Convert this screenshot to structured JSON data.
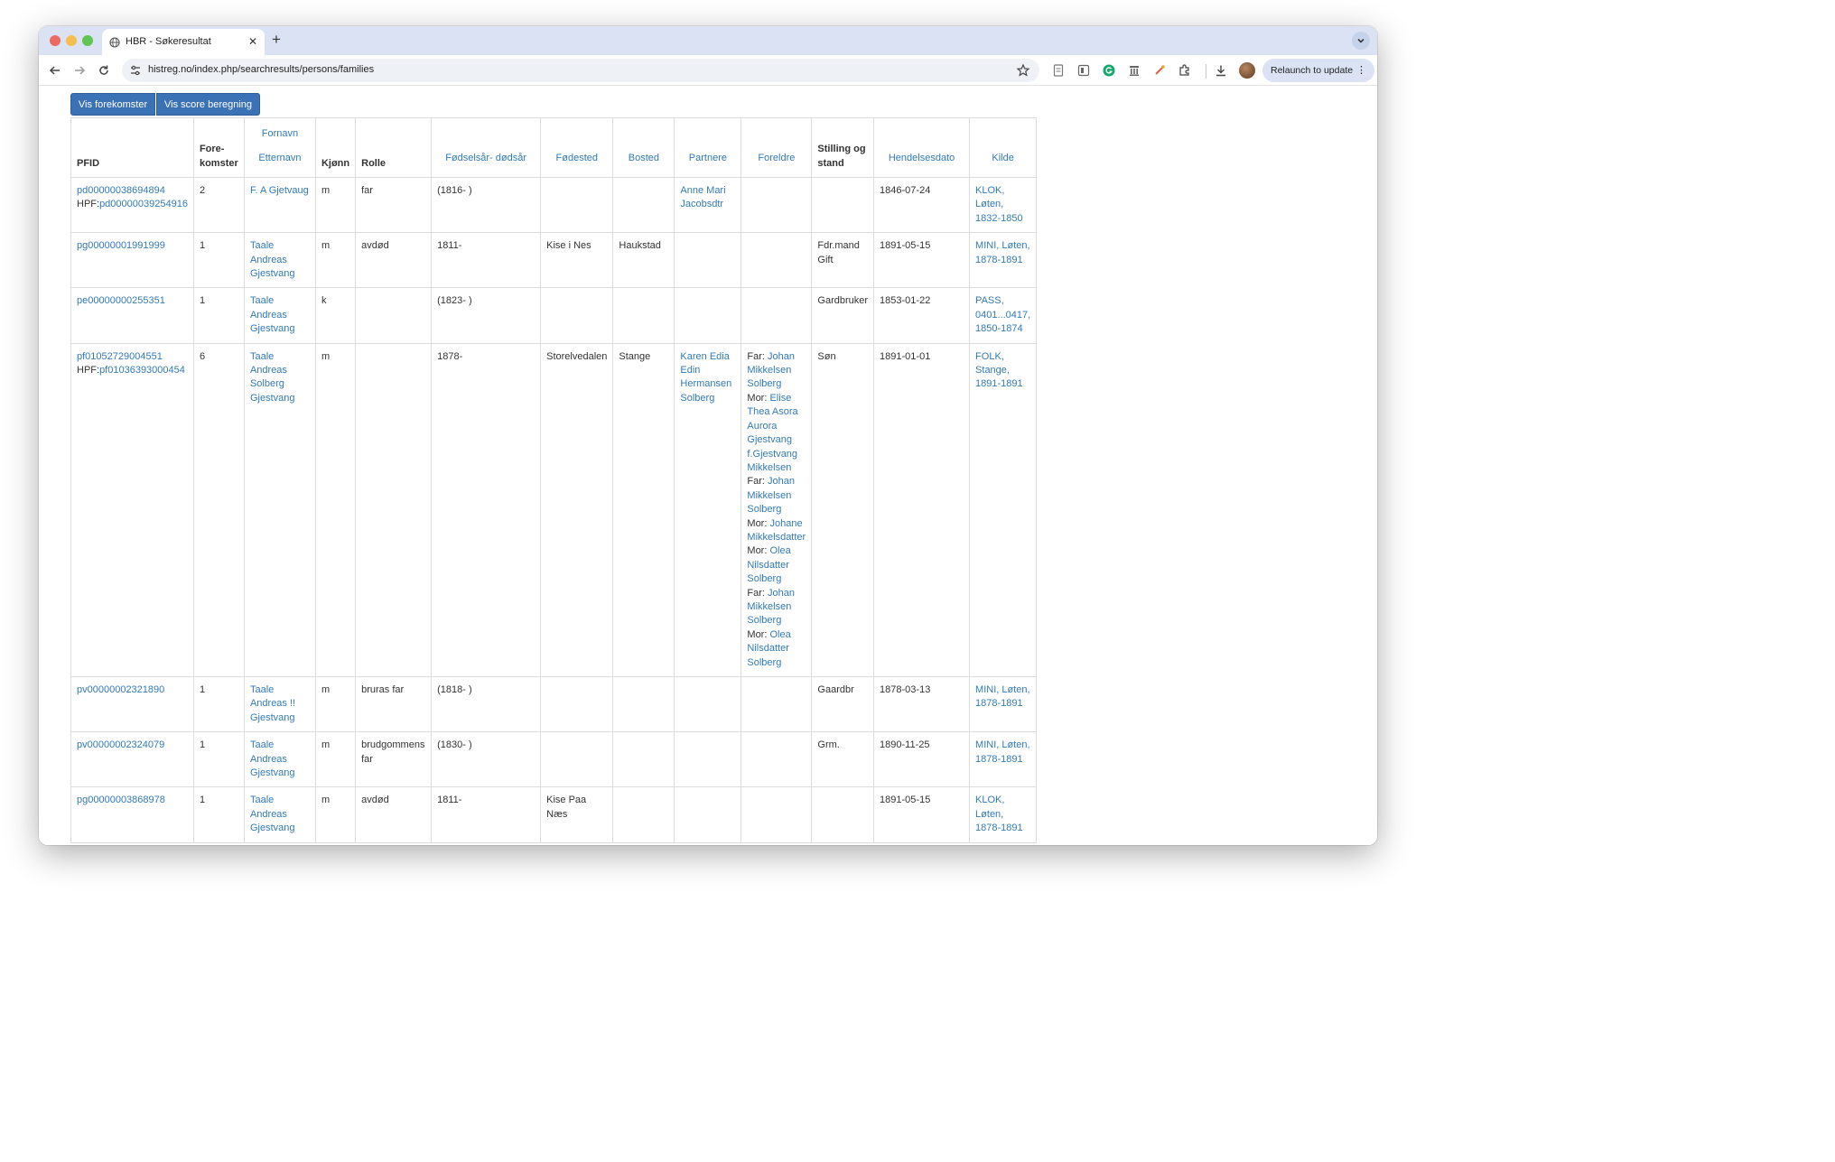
{
  "browser": {
    "tab_title": "HBR - Søkeresultat",
    "url": "histreg.no/index.php/searchresults/persons/families",
    "relaunch_label": "Relaunch to update",
    "new_tab_symbol": "+",
    "close_symbol": "✕"
  },
  "buttons": {
    "show_occurrences": "Vis forekomster",
    "show_score": "Vis score beregning"
  },
  "table": {
    "headers": {
      "pfid": "PFID",
      "occurrences": "Fore-\nkomster",
      "first_name": "Fornavn",
      "last_name": "Etternavn",
      "gender": "Kjønn",
      "role": "Rolle",
      "birth_death": "Fødselsår- dødsår",
      "birthplace": "Fødested",
      "residence": "Bosted",
      "partners": "Partnere",
      "parents": "Foreldre",
      "position": "Stilling og stand",
      "event_date": "Hendelsesdato",
      "source": "Kilde"
    },
    "rows": [
      {
        "pfid": "pd00000038694894",
        "hpf_label": "HPF:",
        "hpf": "pd00000039254916",
        "occurrences": "2",
        "name": "F. A Gjetvaug",
        "gender": "m",
        "role": "far",
        "birth_death": "(1816- )",
        "birthplace": "",
        "residence": "",
        "partners": "Anne Mari Jacobsdtr",
        "parents": [],
        "position": "",
        "event_date": "1846-07-24",
        "source": "KLOK, Løten, 1832-1850"
      },
      {
        "pfid": "pg00000001991999",
        "occurrences": "1",
        "name": "Taale Andreas Gjestvang",
        "gender": "m",
        "role": "avdød",
        "birth_death": "1811-",
        "birthplace": "Kise i Nes",
        "residence": "Haukstad",
        "partners": "",
        "parents": [],
        "position": "Fdr.mand\nGift",
        "event_date": "1891-05-15",
        "source": "MINI, Løten, 1878-1891"
      },
      {
        "pfid": "pe00000000255351",
        "occurrences": "1",
        "name": "Taale Andreas Gjestvang",
        "gender": "k",
        "role": "",
        "birth_death": "(1823- )",
        "birthplace": "",
        "residence": "",
        "partners": "",
        "parents": [],
        "position": "Gardbruker",
        "event_date": "1853-01-22",
        "source": "PASS, 0401...0417, 1850-1874"
      },
      {
        "pfid": "pf01052729004551",
        "hpf_label": "HPF:",
        "hpf": "pf01036393000454",
        "occurrences": "6",
        "name": "Taale Andreas Solberg Gjestvang",
        "gender": "m",
        "role": "",
        "birth_death": "1878-",
        "birthplace": "Storelvedalen",
        "residence": "Stange",
        "partners": "Karen Edia Edin Hermansen Solberg",
        "parents": [
          {
            "label": "Far: ",
            "name": "Johan Mikkelsen Solberg"
          },
          {
            "label": "Mor: ",
            "name": "Elise Thea Asora Aurora Gjestvang f.Gjestvang Mikkelsen"
          },
          {
            "label": "Far: ",
            "name": "Johan Mikkelsen Solberg"
          },
          {
            "label": "Mor: ",
            "name": "Johane Mikkelsdatter"
          },
          {
            "label": "Mor: ",
            "name": "Olea Nilsdatter Solberg"
          },
          {
            "label": "Far: ",
            "name": "Johan Mikkelsen Solberg"
          },
          {
            "label": "Mor: ",
            "name": "Olea Nilsdatter Solberg"
          }
        ],
        "position": "Søn",
        "event_date": "1891-01-01",
        "source": "FOLK, Stange, 1891-1891"
      },
      {
        "pfid": "pv00000002321890",
        "occurrences": "1",
        "name": "Taale Andreas !! Gjestvang",
        "gender": "m",
        "role": "bruras far",
        "birth_death": "(1818- )",
        "birthplace": "",
        "residence": "",
        "partners": "",
        "parents": [],
        "position": "Gaardbr",
        "event_date": "1878-03-13",
        "source": "MINI, Løten, 1878-1891"
      },
      {
        "pfid": "pv00000002324079",
        "occurrences": "1",
        "name": "Taale Andreas Gjestvang",
        "gender": "m",
        "role": "brudgommens far",
        "birth_death": "(1830- )",
        "birthplace": "",
        "residence": "",
        "partners": "",
        "parents": [],
        "position": "Grm.",
        "event_date": "1890-11-25",
        "source": "MINI, Løten, 1878-1891"
      },
      {
        "pfid": "pg00000003868978",
        "occurrences": "1",
        "name": "Taale Andreas Gjestvang",
        "gender": "m",
        "role": "avdød",
        "birth_death": "1811-",
        "birthplace": "Kise Paa Næs",
        "residence": "",
        "partners": "",
        "parents": [],
        "position": "",
        "event_date": "1891-05-15",
        "source": "KLOK, Løten, 1878-1891"
      }
    ]
  }
}
